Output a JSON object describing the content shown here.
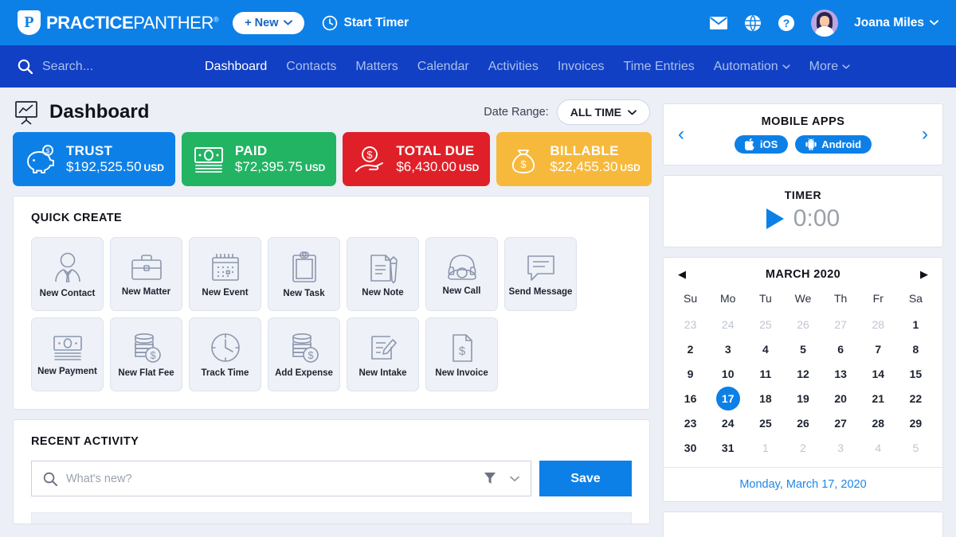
{
  "topbar": {
    "logo_bold": "PRACTICE",
    "logo_light": "PANTHER",
    "logo_mark": "P",
    "registered": "®",
    "new_button": "+ New",
    "start_timer": "Start Timer",
    "mail_icon": "mail-icon",
    "globe_icon": "globe-icon",
    "help_icon": "help-icon",
    "username": "Joana Miles"
  },
  "nav": {
    "search_placeholder": "Search...",
    "links": [
      {
        "label": "Dashboard",
        "active": true,
        "caret": false
      },
      {
        "label": "Contacts",
        "active": false,
        "caret": false
      },
      {
        "label": "Matters",
        "active": false,
        "caret": false
      },
      {
        "label": "Calendar",
        "active": false,
        "caret": false
      },
      {
        "label": "Activities",
        "active": false,
        "caret": false
      },
      {
        "label": "Invoices",
        "active": false,
        "caret": false
      },
      {
        "label": "Time Entries",
        "active": false,
        "caret": false
      },
      {
        "label": "Automation",
        "active": false,
        "caret": true
      },
      {
        "label": "More",
        "active": false,
        "caret": true
      }
    ]
  },
  "page": {
    "title": "Dashboard",
    "title_icon": "presentation-chart-icon",
    "date_range_label": "Date Range:",
    "date_range_value": "ALL TIME"
  },
  "stats": [
    {
      "label": "TRUST",
      "value": "$192,525.50",
      "currency": "USD",
      "color": "#0d80e8",
      "icon": "piggy-bank-icon"
    },
    {
      "label": "PAID",
      "value": "$72,395.75",
      "currency": "USD",
      "color": "#22b463",
      "icon": "money-bill-icon"
    },
    {
      "label": "TOTAL DUE",
      "value": "$6,430.00",
      "currency": "USD",
      "color": "#e02028",
      "icon": "hand-dollar-icon"
    },
    {
      "label": "BILLABLE",
      "value": "$22,455.30",
      "currency": "USD",
      "color": "#f6b93b",
      "icon": "money-bag-icon"
    }
  ],
  "quick_create": {
    "title": "QUICK CREATE",
    "tiles": [
      {
        "label": "New Contact",
        "icon": "person-icon"
      },
      {
        "label": "New Matter",
        "icon": "briefcase-icon"
      },
      {
        "label": "New Event",
        "icon": "calendar-icon"
      },
      {
        "label": "New Task",
        "icon": "clipboard-icon"
      },
      {
        "label": "New Note",
        "icon": "note-pen-icon"
      },
      {
        "label": "New Call",
        "icon": "telephone-icon"
      },
      {
        "label": "Send Message",
        "icon": "chat-bubble-icon"
      },
      {
        "label": "New Payment",
        "icon": "money-bill-icon"
      },
      {
        "label": "New Flat Fee",
        "icon": "coins-dollar-icon"
      },
      {
        "label": "Track Time",
        "icon": "clock-icon"
      },
      {
        "label": "Add Expense",
        "icon": "coins-dollar-icon"
      },
      {
        "label": "New Intake",
        "icon": "form-pencil-icon"
      },
      {
        "label": "New Invoice",
        "icon": "invoice-doc-icon"
      }
    ]
  },
  "recent_activity": {
    "title": "RECENT ACTIVITY",
    "search_placeholder": "What's new?",
    "search_value": "",
    "filter_icon": "funnel-icon",
    "save_label": "Save"
  },
  "mobile_apps": {
    "title": "MOBILE APPS",
    "prev": "‹",
    "next": "›",
    "buttons": [
      {
        "label": "iOS",
        "icon": "apple-icon"
      },
      {
        "label": "Android",
        "icon": "android-icon"
      }
    ]
  },
  "timer": {
    "title": "TIMER",
    "value": "0:00",
    "play_icon": "play-icon"
  },
  "calendar": {
    "title": "MARCH 2020",
    "prev_icon": "triangle-left-icon",
    "next_icon": "triangle-right-icon",
    "prev": "◀",
    "next": "▶",
    "dow": [
      "Su",
      "Mo",
      "Tu",
      "We",
      "Th",
      "Fr",
      "Sa"
    ],
    "days": [
      {
        "d": "23",
        "muted": true
      },
      {
        "d": "24",
        "muted": true
      },
      {
        "d": "25",
        "muted": true
      },
      {
        "d": "26",
        "muted": true
      },
      {
        "d": "27",
        "muted": true
      },
      {
        "d": "28",
        "muted": true
      },
      {
        "d": "1"
      },
      {
        "d": "2"
      },
      {
        "d": "3"
      },
      {
        "d": "4"
      },
      {
        "d": "5"
      },
      {
        "d": "6"
      },
      {
        "d": "7"
      },
      {
        "d": "8"
      },
      {
        "d": "9"
      },
      {
        "d": "10"
      },
      {
        "d": "11"
      },
      {
        "d": "12"
      },
      {
        "d": "13"
      },
      {
        "d": "14"
      },
      {
        "d": "15"
      },
      {
        "d": "16"
      },
      {
        "d": "17",
        "today": true
      },
      {
        "d": "18"
      },
      {
        "d": "19"
      },
      {
        "d": "20"
      },
      {
        "d": "21"
      },
      {
        "d": "22"
      },
      {
        "d": "23"
      },
      {
        "d": "24"
      },
      {
        "d": "25"
      },
      {
        "d": "26"
      },
      {
        "d": "27"
      },
      {
        "d": "28"
      },
      {
        "d": "29"
      },
      {
        "d": "30"
      },
      {
        "d": "31"
      },
      {
        "d": "1",
        "muted": true
      },
      {
        "d": "2",
        "muted": true
      },
      {
        "d": "3",
        "muted": true
      },
      {
        "d": "4",
        "muted": true
      },
      {
        "d": "5",
        "muted": true
      }
    ],
    "footer": "Monday, March 17, 2020"
  },
  "colors": {
    "brand_blue": "#0d80e8",
    "nav_blue": "#1240c4",
    "page_bg": "#eceff6"
  }
}
